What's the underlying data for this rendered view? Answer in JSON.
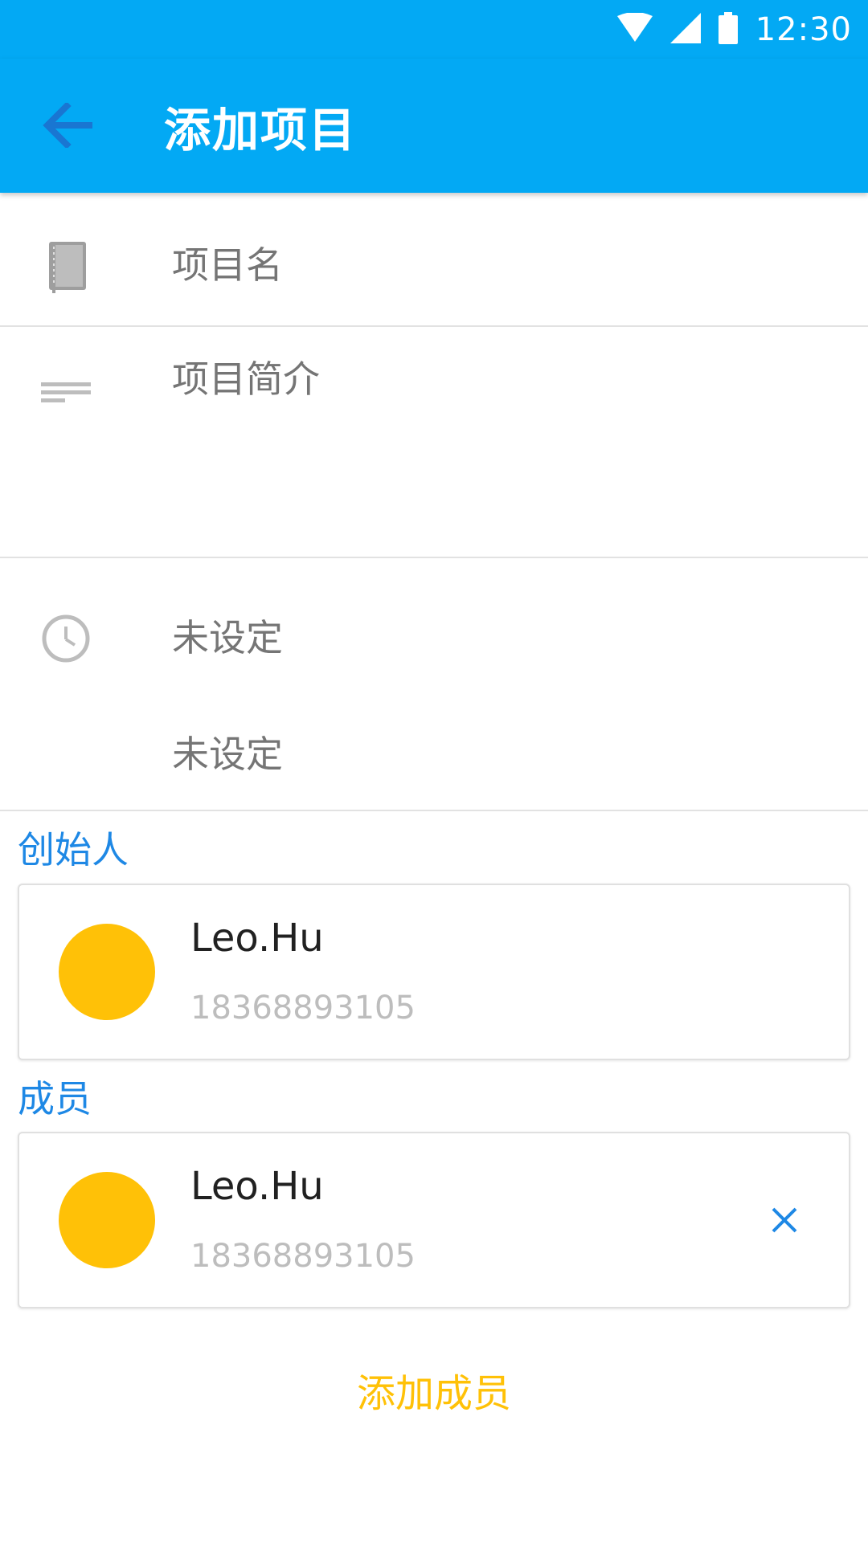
{
  "status_bar": {
    "time": "12:30",
    "icons": [
      "wifi-icon",
      "cellular-signal-icon",
      "battery-icon"
    ]
  },
  "app_bar": {
    "title": "添加项目",
    "back_icon": "arrow-back-icon"
  },
  "form": {
    "project_name": {
      "placeholder": "项目名",
      "value": "",
      "icon": "notebook-icon"
    },
    "project_desc": {
      "placeholder": "项目简介",
      "value": "",
      "icon": "short-text-icon"
    },
    "start_time": {
      "value": "未设定",
      "icon": "clock-icon"
    },
    "end_time": {
      "value": "未设定"
    }
  },
  "creator_section": {
    "label": "创始人",
    "person": {
      "name": "Leo.Hu",
      "phone": "18368893105"
    }
  },
  "members_section": {
    "label": "成员",
    "members": [
      {
        "name": "Leo.Hu",
        "phone": "18368893105",
        "remove_icon": "close-icon"
      }
    ]
  },
  "add_member_label": "添加成员",
  "colors": {
    "primary": "#03A9F4",
    "accent": "#FFC107",
    "section_label": "#1E88E5",
    "avatar": "#FFC107"
  }
}
